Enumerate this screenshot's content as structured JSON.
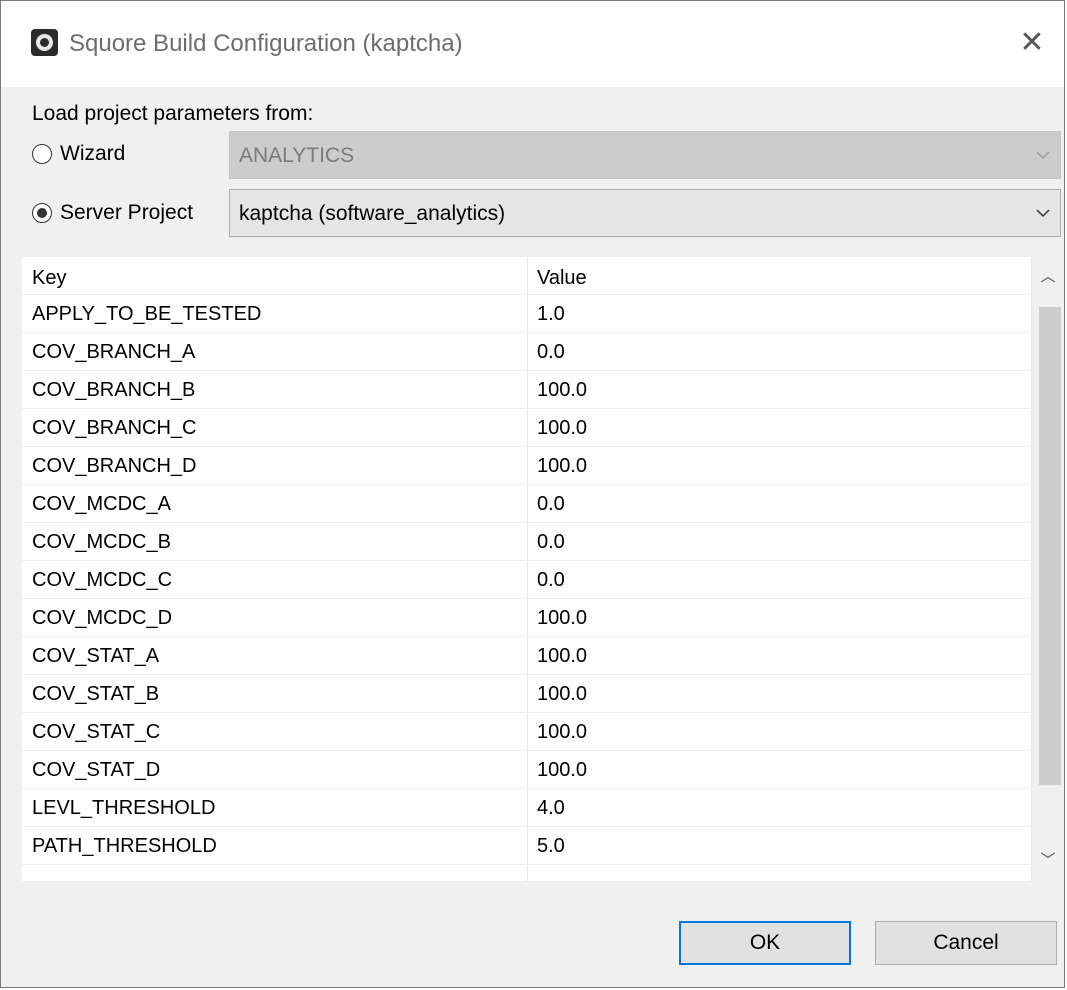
{
  "window": {
    "title": "Squore Build Configuration (kaptcha)",
    "app_icon": "squore-gear-icon",
    "close_icon": "close-icon"
  },
  "form": {
    "load_label": "Load project parameters from:",
    "wizard": {
      "label": "Wizard",
      "selected": false,
      "combo_value": "ANALYTICS",
      "enabled": false
    },
    "server_project": {
      "label": "Server Project",
      "selected": true,
      "combo_value": "kaptcha (software_analytics)",
      "enabled": true
    }
  },
  "table": {
    "columns": [
      "Key",
      "Value"
    ],
    "rows": [
      [
        "APPLY_TO_BE_TESTED",
        "1.0"
      ],
      [
        "COV_BRANCH_A",
        "0.0"
      ],
      [
        "COV_BRANCH_B",
        "100.0"
      ],
      [
        "COV_BRANCH_C",
        "100.0"
      ],
      [
        "COV_BRANCH_D",
        "100.0"
      ],
      [
        "COV_MCDC_A",
        "0.0"
      ],
      [
        "COV_MCDC_B",
        "0.0"
      ],
      [
        "COV_MCDC_C",
        "0.0"
      ],
      [
        "COV_MCDC_D",
        "100.0"
      ],
      [
        "COV_STAT_A",
        "100.0"
      ],
      [
        "COV_STAT_B",
        "100.0"
      ],
      [
        "COV_STAT_C",
        "100.0"
      ],
      [
        "COV_STAT_D",
        "100.0"
      ],
      [
        "LEVL_THRESHOLD",
        "4.0"
      ],
      [
        "PATH_THRESHOLD",
        "5.0"
      ]
    ]
  },
  "buttons": {
    "ok": "OK",
    "cancel": "Cancel"
  },
  "colors": {
    "default_button_border": "#0078d7",
    "disabled_combo_bg": "#cccccc",
    "enabled_combo_bg": "#e5e5e5"
  }
}
